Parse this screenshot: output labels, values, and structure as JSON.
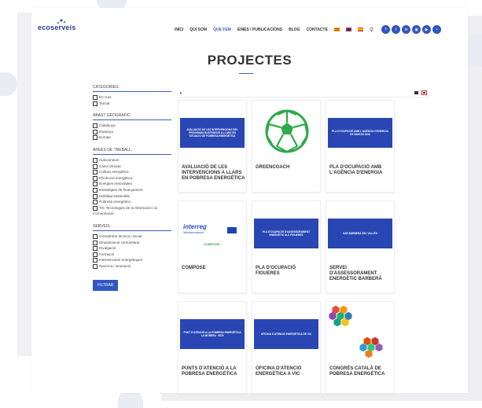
{
  "brand": {
    "logo_text": "ecoserveis",
    "accent": "#2f56c1"
  },
  "nav": {
    "items": [
      {
        "label": "INICI",
        "active": false
      },
      {
        "label": "QUI SOM",
        "active": false
      },
      {
        "label": "QUE FEM",
        "active": true
      },
      {
        "label": "EINES I PUBLICACIONS",
        "active": false
      },
      {
        "label": "BLOG",
        "active": false
      },
      {
        "label": "CONTACTE",
        "active": false
      }
    ],
    "flags": [
      "catalan-flag",
      "english-flag",
      "spanish-flag"
    ],
    "social_icons": [
      "facebook-icon",
      "twitter-icon",
      "linkedin-icon",
      "instagram-icon",
      "youtube-icon",
      "flickr-icon"
    ]
  },
  "page_title": "PROJECTES",
  "filters": [
    {
      "heading": "CATEGORIES:",
      "options": [
        "En curs",
        "Tancat"
      ]
    },
    {
      "heading": "ABAST GEOGRÀFIC:",
      "options": [
        "Catalunya",
        "Espanya",
        "Europa"
      ]
    },
    {
      "heading": "ÀREES DE TREBALL:",
      "options": [
        "Autoconsum",
        "Canvi climàtic",
        "Cultura energètica",
        "Eficiència energètica",
        "Energies renovables",
        "Estratègies de finançament",
        "Mobilitat sostenible",
        "Pobresa energètica",
        "TIC Tecnologies de la Informació i la",
        "Comunicació"
      ]
    },
    {
      "heading": "SERVEIS:",
      "options": [
        "Consultoria tècnica i social",
        "Dinamització comunitària",
        "Divulgació",
        "Formació",
        "Intervencions energètiques",
        "Recerca i innovació"
      ]
    }
  ],
  "filter_button": "FILTRAR",
  "cards": [
    {
      "title": "AVALUACIÓ DE LES INTERVENCIONS A LLARS EN POBRESA ENERGÈTICA",
      "banner": "AVALUACIÓ DE LES INTERVENCIONS DEL PROGRAMA BUSTENGUS A LLARS EN SITUACIÓ DE POBRESA ENERGÈTICA",
      "type": "banner"
    },
    {
      "title": "GREENCOACH",
      "type": "football"
    },
    {
      "title": "PLA D'OCUPACIÓ AMB L'AGÈNCIA D'ENERGIA",
      "banner": "PLA D'OCUPACIÓ AMB L'AGÈNCIA D'ENERGIA DE BARCELONA",
      "type": "banner"
    },
    {
      "title": "COMPOSE",
      "type": "interreg",
      "logo": "interreg",
      "logo_sub": "Mediterranean",
      "logo_mark": "COMPOSE"
    },
    {
      "title": "PLA D'OCUPACIÓ FIGUERES",
      "banner": "PLA D'OCUPACIÓ D'ASSESSORAMENT ENERGÈTIC ALS FIGUERES",
      "type": "banner"
    },
    {
      "title": "SERVEI D'ASSESSORAMENT ENERGÈTIC BARBERÀ",
      "banner": "SAE BARBERÀ DEL VALLÈS",
      "type": "banner"
    },
    {
      "title": "PUNTS D'ATENCIÓ A LA POBRESA ENERGÈTICA",
      "banner": "PUNT D'ATENCIÓ A LA POBRESA ENERGÈTICA LA MORERA · BCN",
      "type": "banner"
    },
    {
      "title": "OFICINA D'ATENCIÓ ENERGÈTICA A VIC",
      "banner": "OFICINA D'ATENCIÓ ENERGÈTICA DE VIC",
      "type": "banner"
    },
    {
      "title": "CONGRÉS CATALÀ DE POBRESA ENERGÈTICA",
      "type": "hexagons"
    }
  ]
}
